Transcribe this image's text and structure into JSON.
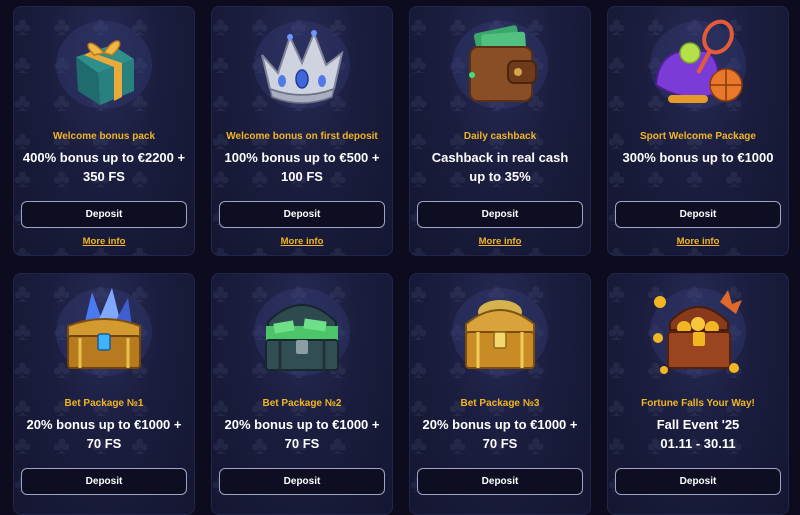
{
  "colors": {
    "accent": "#f2b623",
    "background": "#0c0c1e",
    "card": "#1a1d3d"
  },
  "cards": [
    {
      "icon": "gift-box-icon",
      "subtitle": "Welcome bonus pack",
      "title": "400% bonus up to €2200 +\n350 FS",
      "button": "Deposit",
      "more": "More info"
    },
    {
      "icon": "silver-crown-icon",
      "subtitle": "Welcome bonus on first deposit",
      "title": "100% bonus up to €500 +\n100 FS",
      "button": "Deposit",
      "more": "More info"
    },
    {
      "icon": "wallet-cash-icon",
      "subtitle": "Daily cashback",
      "title": "Cashback in real cash\nup to 35%",
      "button": "Deposit",
      "more": "More info"
    },
    {
      "icon": "sport-bag-icon",
      "subtitle": "Sport Welcome Package",
      "title": "300% bonus up to €1000",
      "button": "Deposit",
      "more": "More info"
    },
    {
      "icon": "crystal-chest-icon",
      "subtitle": "Bet Package №1",
      "title": "20% bonus up to €1000 +\n70 FS",
      "button": "Deposit"
    },
    {
      "icon": "money-chest-icon",
      "subtitle": "Bet Package №2",
      "title": "20% bonus up to €1000 +\n70 FS",
      "button": "Deposit"
    },
    {
      "icon": "gold-chest-icon",
      "subtitle": "Bet Package №3",
      "title": "20% bonus up to €1000 +\n70 FS",
      "button": "Deposit"
    },
    {
      "icon": "coin-chest-icon",
      "subtitle": "Fortune Falls Your Way!",
      "title": "Fall Event '25\n01.11 - 30.11",
      "button": "Deposit"
    }
  ]
}
